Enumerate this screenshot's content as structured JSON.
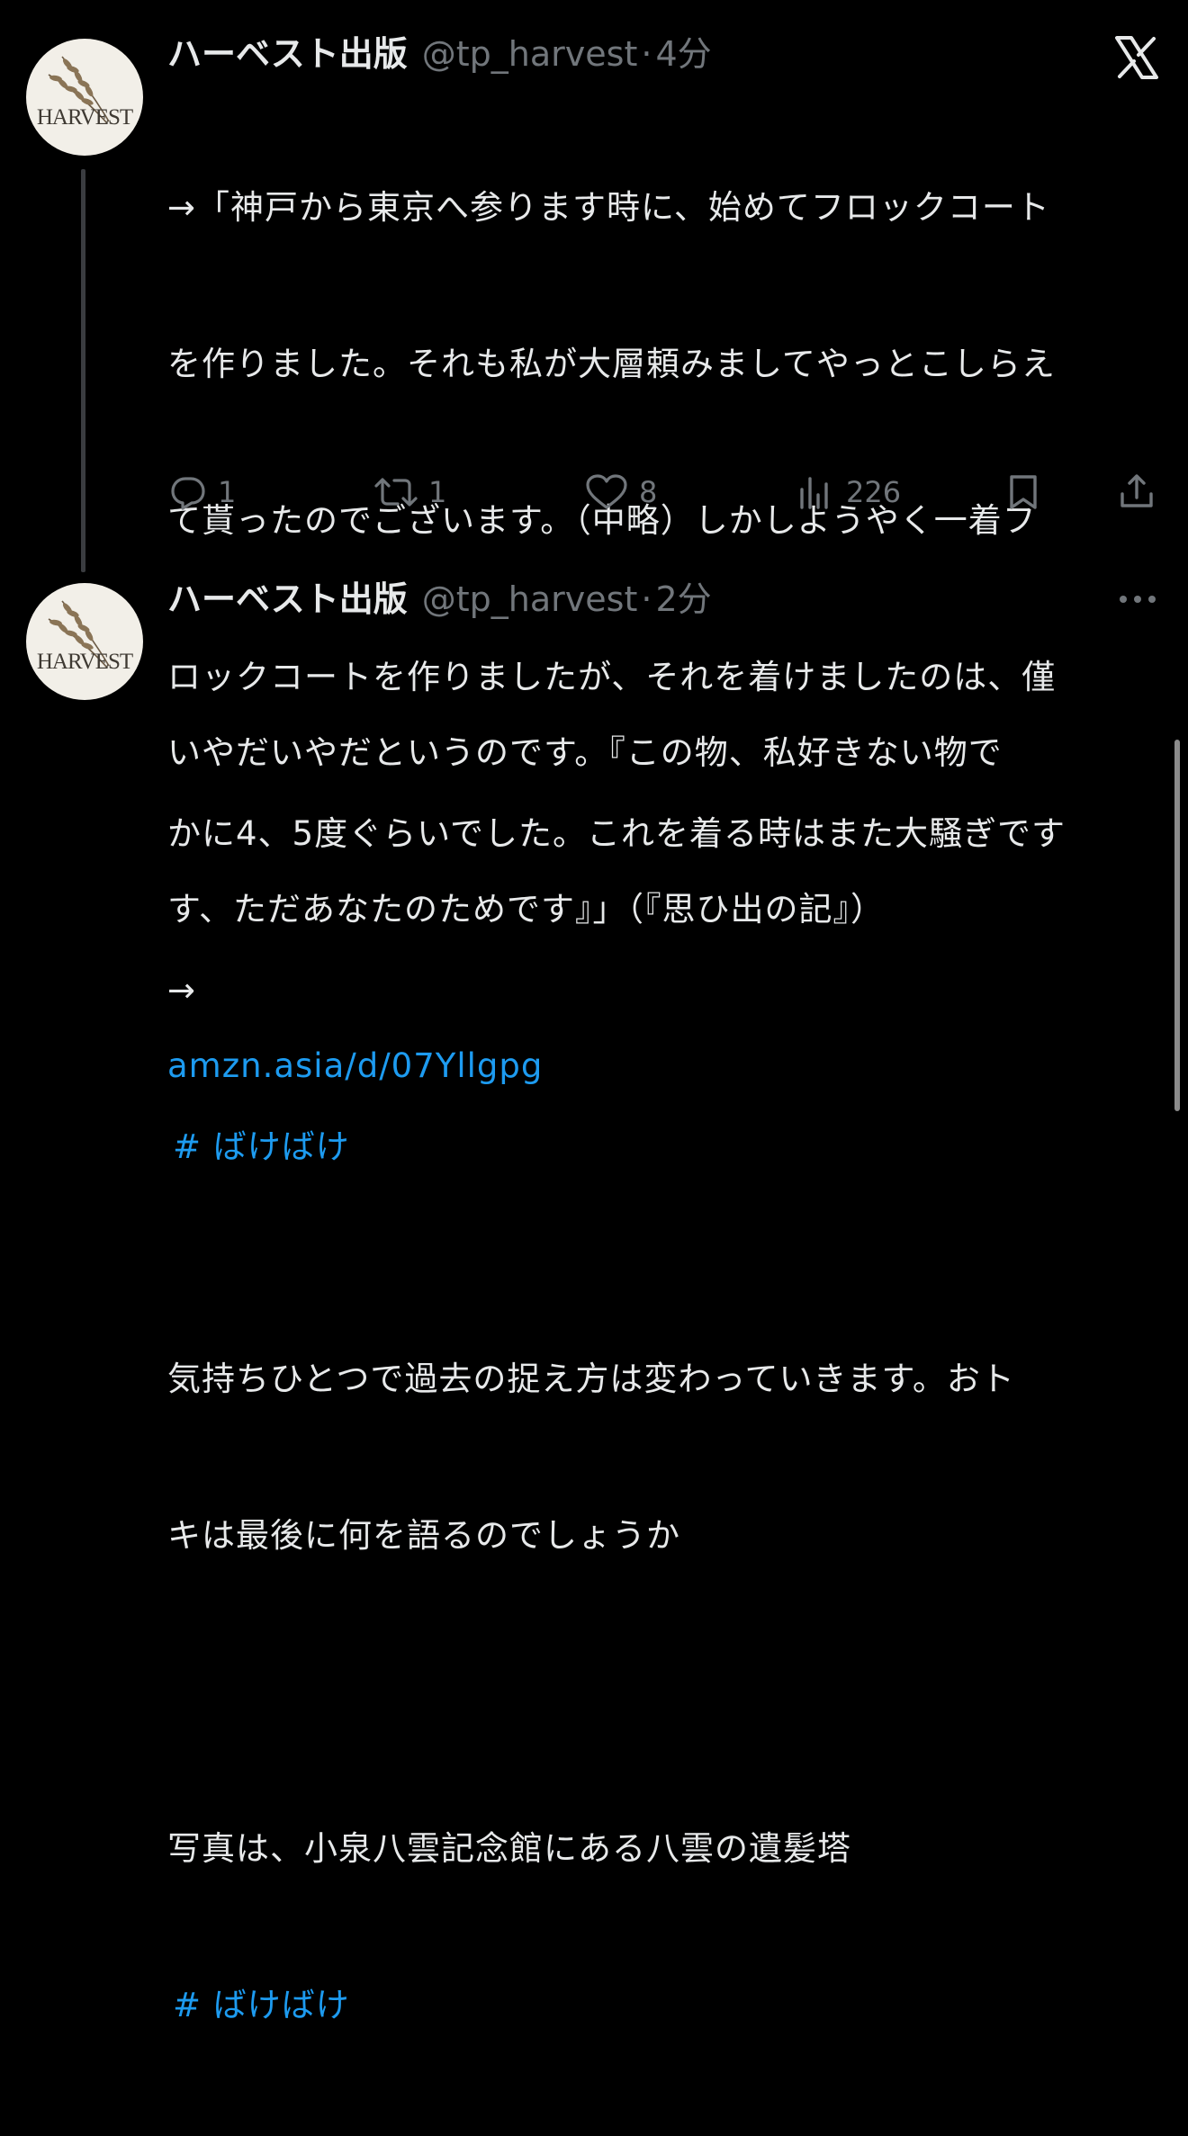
{
  "tweets": [
    {
      "author_name": "ハーベスト出版",
      "handle": "@tp_harvest",
      "separator": "·",
      "time": "4分",
      "avatar_text": "HARVEST",
      "lines": [
        "→「神戸から東京へ参ります時に、始めてフロックコート",
        "を作りました。それも私が大層頼みましてやっとこしらえ",
        "て貰ったのでございます。（中略）しかしようやく一着フ",
        "ロックコートを作りましたが、それを着けましたのは、僅",
        "かに4、5度ぐらいでした。これを着る時はまた大騒ぎです",
        "→"
      ],
      "hashtag": "# ばけばけ",
      "actions": {
        "replies": "1",
        "reposts": "1",
        "likes": "8",
        "views": "226"
      }
    },
    {
      "author_name": "ハーベスト出版",
      "handle": "@tp_harvest",
      "separator": "·",
      "time": "2分",
      "avatar_text": "HARVEST",
      "lines_1": [
        "いやだいやだというのです。『この物、私好きない物で",
        "す、ただあなたのためです』」（『思ひ出の記』）"
      ],
      "link": "amzn.asia/d/07Yllgpg",
      "lines_2": [
        "気持ちひとつで過去の捉え方は変わっていきます。おト",
        "キは最後に何を語るのでしょうか"
      ],
      "lines_3": [
        "写真は、小泉八雲記念館にある八雲の遺髪塔"
      ],
      "hashtag": "# ばけばけ"
    }
  ],
  "icons": {
    "top_right": "x-logo-icon",
    "more": "more-horizontal-icon",
    "reply": "reply-icon",
    "repost": "repost-icon",
    "like": "heart-icon",
    "views": "views-icon",
    "bookmark": "bookmark-icon",
    "share": "share-icon"
  },
  "colors": {
    "background": "#000000",
    "text": "#e7e9ea",
    "secondary": "#71767b",
    "link": "#1d9bf0"
  }
}
